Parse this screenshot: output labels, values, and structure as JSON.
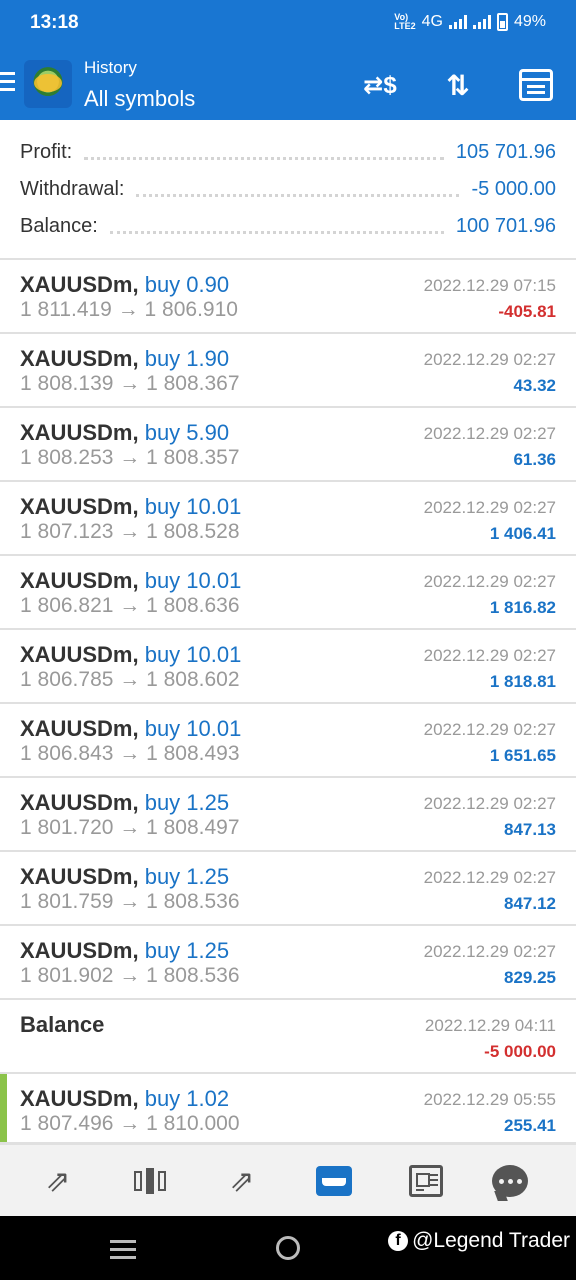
{
  "status_bar": {
    "time": "13:18",
    "network_lte": "VoLTE2",
    "network_type": "4G",
    "battery": "49%"
  },
  "app_bar": {
    "subtitle": "History",
    "title": "All symbols",
    "icons": [
      "menu-icon",
      "exchange-icon",
      "sort-icon",
      "calendar-icon"
    ]
  },
  "summary": {
    "profit_label": "Profit:",
    "profit_value": "105 701.96",
    "withdrawal_label": "Withdrawal:",
    "withdrawal_value": "-5 000.00",
    "balance_label": "Balance:",
    "balance_value": "100 701.96"
  },
  "deals": [
    {
      "symbol": "XAUUSDm,",
      "type": "buy 0.90",
      "prices": "1 811.419 → 1 806.910",
      "date": "2022.12.29 07:15",
      "pl": "-405.81",
      "sign": "neg"
    },
    {
      "symbol": "XAUUSDm,",
      "type": "buy 1.90",
      "prices": "1 808.139 → 1 808.367",
      "date": "2022.12.29 02:27",
      "pl": "43.32",
      "sign": "pos"
    },
    {
      "symbol": "XAUUSDm,",
      "type": "buy 5.90",
      "prices": "1 808.253 → 1 808.357",
      "date": "2022.12.29 02:27",
      "pl": "61.36",
      "sign": "pos"
    },
    {
      "symbol": "XAUUSDm,",
      "type": "buy 10.01",
      "prices": "1 807.123 → 1 808.528",
      "date": "2022.12.29 02:27",
      "pl": "1 406.41",
      "sign": "pos"
    },
    {
      "symbol": "XAUUSDm,",
      "type": "buy 10.01",
      "prices": "1 806.821 → 1 808.636",
      "date": "2022.12.29 02:27",
      "pl": "1 816.82",
      "sign": "pos"
    },
    {
      "symbol": "XAUUSDm,",
      "type": "buy 10.01",
      "prices": "1 806.785 → 1 808.602",
      "date": "2022.12.29 02:27",
      "pl": "1 818.81",
      "sign": "pos"
    },
    {
      "symbol": "XAUUSDm,",
      "type": "buy 10.01",
      "prices": "1 806.843 → 1 808.493",
      "date": "2022.12.29 02:27",
      "pl": "1 651.65",
      "sign": "pos"
    },
    {
      "symbol": "XAUUSDm,",
      "type": "buy 1.25",
      "prices": "1 801.720 → 1 808.497",
      "date": "2022.12.29 02:27",
      "pl": "847.13",
      "sign": "pos"
    },
    {
      "symbol": "XAUUSDm,",
      "type": "buy 1.25",
      "prices": "1 801.759 → 1 808.536",
      "date": "2022.12.29 02:27",
      "pl": "847.12",
      "sign": "pos"
    },
    {
      "symbol": "XAUUSDm,",
      "type": "buy 1.25",
      "prices": "1 801.902 → 1 808.536",
      "date": "2022.12.29 02:27",
      "pl": "829.25",
      "sign": "pos"
    },
    {
      "symbol": "Balance",
      "type": "",
      "prices": "",
      "date": "2022.12.29 04:11",
      "pl": "-5 000.00",
      "sign": "neg"
    },
    {
      "symbol": "XAUUSDm,",
      "type": "buy 1.02",
      "prices": "1 807.496 → 1 810.000",
      "date": "2022.12.29 05:55",
      "pl": "255.41",
      "sign": "pos",
      "active": true
    }
  ],
  "bottom_nav": {
    "items": [
      "quotes-icon",
      "chart-icon",
      "trade-icon",
      "history-icon",
      "news-icon",
      "chat-icon"
    ],
    "active": "history-icon"
  },
  "watermark": "@Legend Trader",
  "colors": {
    "primary": "#1976d2",
    "positive": "#1a73c6",
    "negative": "#d32f2f",
    "active_marker": "#8bc34a"
  }
}
